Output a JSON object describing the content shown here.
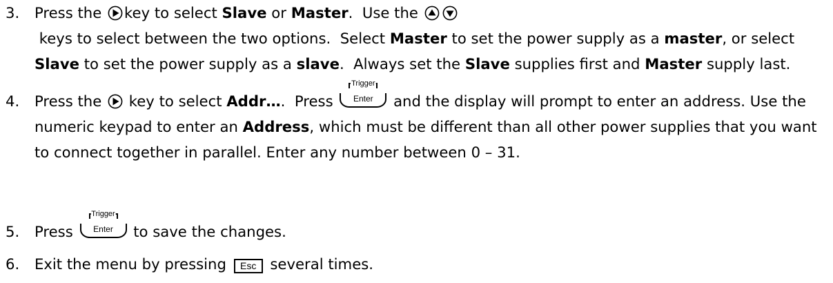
{
  "step3": {
    "num": "3.",
    "t1": "Press the ",
    "t2": "key to select ",
    "b1": "Slave",
    "t3": " or ",
    "b2": "Master",
    "t4": ".  Use the ",
    "t5": " keys to select between the two options.  Select ",
    "b3": "Master",
    "t6": " to set the power supply as a ",
    "b4": "master",
    "t7": ", or select ",
    "b5": "Slave",
    "t8": " to set the power supply as a ",
    "b6": "slave",
    "t9": ".  Always set the ",
    "b7": "Slave",
    "t10": " supplies first and ",
    "b8": "Master",
    "t11": " supply last."
  },
  "step4": {
    "num": "4.",
    "t1": "Press the ",
    "t2": " key to select ",
    "b1": "Addr…",
    "t3": ".  Press ",
    "t4": " and the display will prompt to enter an address.  Use the numeric keypad to enter an ",
    "b2": "Address",
    "t5": ", which must be different than all other power supplies that you want to connect together in parallel.  Enter any number between 0 – 31."
  },
  "step5": {
    "num": "5.",
    "t1": "Press ",
    "t2": " to save the changes."
  },
  "step6": {
    "num": "6.",
    "t1": "Exit the menu by pressing ",
    "t2": " several times."
  },
  "keys": {
    "enter_label": "Enter",
    "trigger_label": "Trigger",
    "esc_label": "Esc"
  },
  "icons": {
    "right": "right-arrow-circle-icon",
    "up": "up-arrow-circle-icon",
    "down": "down-arrow-circle-icon"
  }
}
